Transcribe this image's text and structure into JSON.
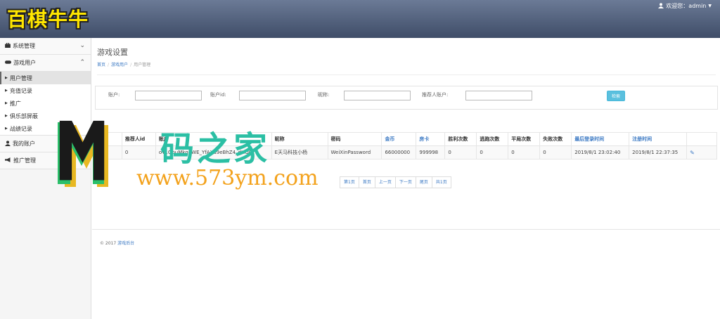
{
  "header": {
    "logo": "百棋牛牛",
    "welcome": "欢迎您：admin",
    "user_icon": "user-icon",
    "caret_icon": "caret-down-icon"
  },
  "sidebar": {
    "groups": [
      {
        "label": "系统管理",
        "icon": "briefcase-icon",
        "state": "collapsed"
      },
      {
        "label": "游戏用户",
        "icon": "gamepad-icon",
        "state": "expanded",
        "items": [
          "用户管理",
          "充值记录",
          "推广",
          "俱乐部屏蔽",
          "战绩记录"
        ]
      },
      {
        "label": "我的账户",
        "icon": "user-icon"
      },
      {
        "label": "推广管理",
        "icon": "bullhorn-icon"
      }
    ],
    "active_item": "用户管理"
  },
  "main": {
    "title": "游戏设置",
    "breadcrumb": [
      "首页",
      "游戏用户",
      "用户管理"
    ],
    "search": {
      "labels": [
        "账户:",
        "账户id:",
        "昵称:",
        "推荐人账户:"
      ],
      "values": [
        "",
        "",
        "",
        ""
      ],
      "button": "检索"
    },
    "table": {
      "headers": [
        "ID",
        "推荐人id",
        "账户",
        "昵称",
        "密码",
        "金币",
        "房卡",
        "胜利次数",
        "逃跑次数",
        "平局次数",
        "失败次数",
        "最后登录时间",
        "注册时间",
        ""
      ],
      "rows": [
        [
          "1",
          "0",
          "oY1ObuMkq4WE_YfAXu9eBhZ4_dHOO",
          "E天马科技小杨",
          "WeiXinPassword",
          "66000000",
          "999998",
          "0",
          "0",
          "0",
          "0",
          "2019/8/1 23:02:40",
          "2019/8/1 22:37:35",
          ""
        ]
      ]
    },
    "pagination": [
      "第1页",
      "首页",
      "上一页",
      "下一页",
      "尾页",
      "共1页"
    ],
    "footer": {
      "copyright": "© 2017",
      "link": "游戏后台"
    }
  },
  "watermark": {
    "title": "码之家",
    "url": "www.573ym.com"
  },
  "colors": {
    "header": "#4f5d79",
    "logo": "#ffe600",
    "link": "#3a78c3",
    "button": "#5bc0de",
    "watermark_green": "#2bbfa4",
    "watermark_orange": "#f3a21c"
  }
}
